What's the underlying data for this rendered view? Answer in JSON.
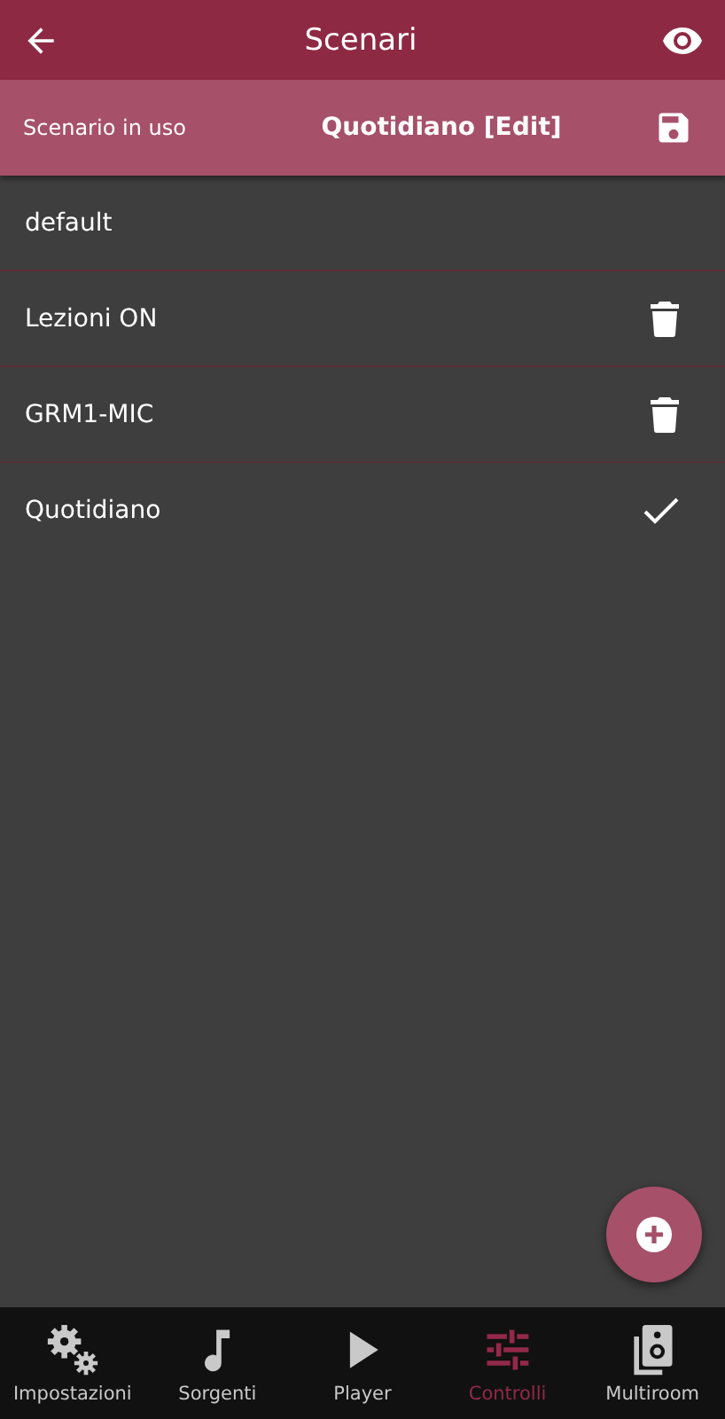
{
  "header": {
    "title": "Scenari"
  },
  "current_scenario": {
    "label": "Scenario in uso",
    "value": "Quotidiano [Edit]"
  },
  "scenarios": [
    {
      "name": "default",
      "selected": false,
      "deletable": false
    },
    {
      "name": "Lezioni ON",
      "selected": false,
      "deletable": true
    },
    {
      "name": "GRM1-MIC",
      "selected": false,
      "deletable": true
    },
    {
      "name": "Quotidiano",
      "selected": true,
      "deletable": false
    }
  ],
  "bottom_nav": [
    {
      "kind": "settings",
      "label": "Impostazioni",
      "selected": false
    },
    {
      "kind": "music",
      "label": "Sorgenti",
      "selected": false
    },
    {
      "kind": "play",
      "label": "Player",
      "selected": false
    },
    {
      "kind": "sliders",
      "label": "Controlli",
      "selected": true
    },
    {
      "kind": "speaker",
      "label": "Multiroom",
      "selected": false
    }
  ]
}
